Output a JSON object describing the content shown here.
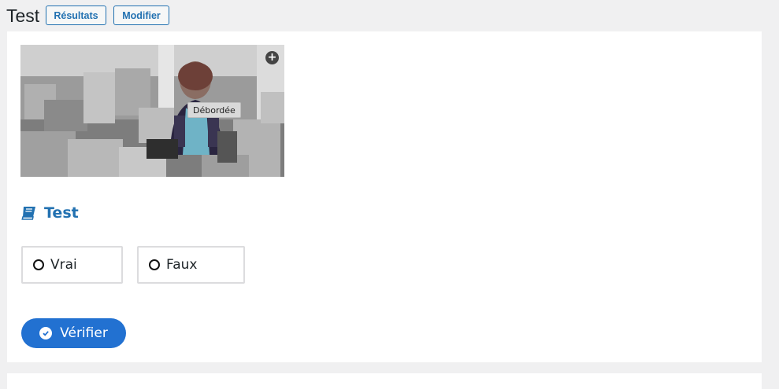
{
  "header": {
    "title": "Test",
    "results_label": "Résultats",
    "edit_label": "Modifier"
  },
  "media": {
    "tooltip": "Débordée",
    "expand_icon": "plus-circle-icon"
  },
  "question": {
    "icon": "book-icon",
    "title": "Test",
    "answers": [
      {
        "label": "Vrai",
        "selected": false
      },
      {
        "label": "Faux",
        "selected": false
      }
    ],
    "verify_label": "Vérifier",
    "verify_icon": "check-circle-icon"
  },
  "colors": {
    "accent": "#2271b1",
    "button": "#2271d1",
    "background": "#f0f0f1"
  }
}
